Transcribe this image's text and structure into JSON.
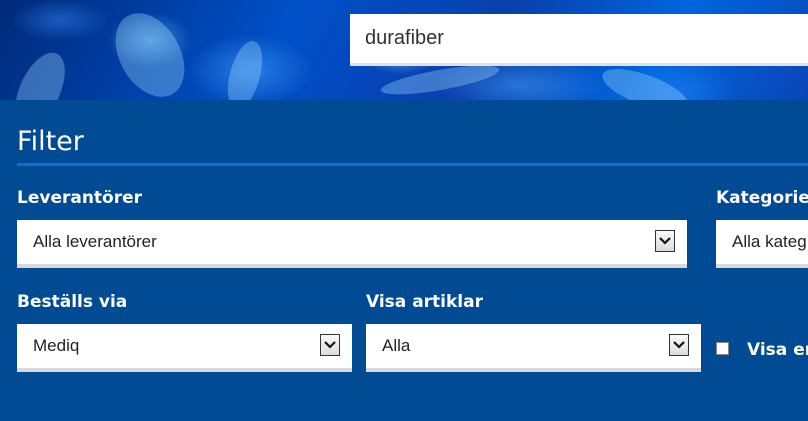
{
  "search": {
    "value": "durafiber"
  },
  "filter": {
    "title": "Filter",
    "suppliers": {
      "label": "Leverantörer",
      "selected": "Alla leverantörer"
    },
    "categories": {
      "label": "Kategorier",
      "selected": "Alla kateg"
    },
    "order_via": {
      "label": "Beställs via",
      "selected": "Mediq"
    },
    "show_articles": {
      "label": "Visa artiklar",
      "selected": "Alla"
    },
    "checkbox": {
      "label": "Visa en"
    }
  }
}
